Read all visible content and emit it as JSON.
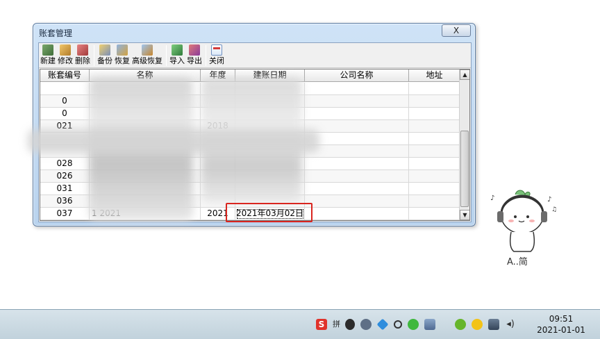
{
  "window": {
    "title": "账套管理",
    "close_label": "X"
  },
  "toolbar": {
    "buttons": [
      {
        "label": "新建",
        "icon": "new-icon"
      },
      {
        "label": "修改",
        "icon": "edit-icon"
      },
      {
        "label": "删除",
        "icon": "delete-icon"
      },
      {
        "label": "备份",
        "icon": "backup-icon"
      },
      {
        "label": "恢复",
        "icon": "restore-icon"
      },
      {
        "label": "高级恢复",
        "icon": "advanced-restore-icon"
      },
      {
        "label": "导入",
        "icon": "import-icon"
      },
      {
        "label": "导出",
        "icon": "export-icon"
      },
      {
        "label": "关闭",
        "icon": "close-window-icon"
      }
    ]
  },
  "grid": {
    "columns": [
      "账套编号",
      "名称",
      "年度",
      "建账日期",
      "公司名称",
      "地址"
    ],
    "rows": [
      {
        "code": "",
        "name": "",
        "year": "",
        "date": "",
        "company": "",
        "address": ""
      },
      {
        "code": "0",
        "name": "",
        "year": "",
        "date": "",
        "company": "",
        "address": ""
      },
      {
        "code": "0",
        "name": "",
        "year": "",
        "date": "",
        "company": "",
        "address": ""
      },
      {
        "code": "021",
        "name": "",
        "year": "2018",
        "date": "",
        "company": "",
        "address": ""
      },
      {
        "code": "",
        "name": "",
        "year": "",
        "date": "",
        "company": "",
        "address": ""
      },
      {
        "code": "",
        "name": "",
        "year": "",
        "date": "",
        "company": "",
        "address": ""
      },
      {
        "code": "028",
        "name": "",
        "year": "",
        "date": "",
        "company": "",
        "address": ""
      },
      {
        "code": "026",
        "name": "",
        "year": "",
        "date": "",
        "company": "",
        "address": ""
      },
      {
        "code": "031",
        "name": "",
        "year": "",
        "date": "",
        "company": "",
        "address": ""
      },
      {
        "code": "036",
        "name": "",
        "year": "",
        "date": "",
        "company": "",
        "address": ""
      },
      {
        "code": "037",
        "name": "1 2021",
        "year": "2021",
        "date": "2021年03月02日",
        "company": "",
        "address": ""
      }
    ]
  },
  "sticker": {
    "caption": "A..简"
  },
  "taskbar": {
    "tray_icons": [
      "sogou-input-icon",
      "keyboard-icon",
      "pen-icon",
      "shield-icon",
      "cube-icon",
      "search-icon",
      "wechat-icon",
      "network-icon",
      "green-app-icon",
      "yellow-app-icon",
      "action-center-icon",
      "volume-icon"
    ],
    "sogou_label": "S",
    "kb_label": "拼",
    "vol_label": "◂)",
    "clock_time": "09:51",
    "clock_date": "2021-01-01"
  },
  "colors": {
    "highlight": "#d9251f",
    "title_bar": "#cfe3f7"
  }
}
